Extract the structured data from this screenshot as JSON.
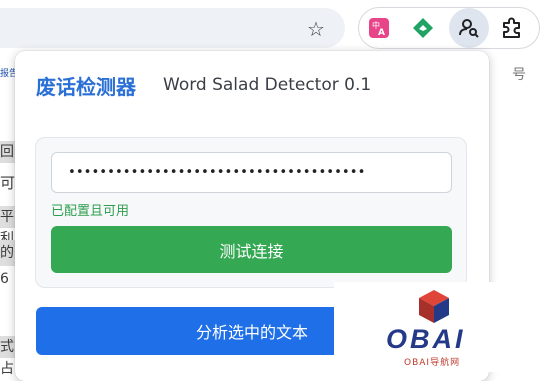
{
  "toolbar": {
    "bookmark_icon": "star-outline",
    "extensions": [
      {
        "name": "translate-extension",
        "icon": "translate-icon",
        "color": "#e8448a"
      },
      {
        "name": "green-extension",
        "icon": "leaf-icon",
        "color": "#21a366"
      },
      {
        "name": "word-salad-detector",
        "icon": "person-search-icon",
        "active": true
      },
      {
        "name": "extensions-menu",
        "icon": "puzzle-icon"
      }
    ]
  },
  "background": {
    "logo_snippet": "报告",
    "right_char": "号",
    "lines": [
      "回",
      "可能",
      "平利",
      "的6",
      "式占"
    ]
  },
  "popup": {
    "title": "废话检测器",
    "subtitle": "Word Salad Detector 0.1",
    "api_key_masked": "••••••••••••••••••••••••••••••••••••••",
    "status": "已配置且可用",
    "test_button": "测试连接",
    "analyze_button": "分析选中的文本"
  },
  "watermark": {
    "text": "OBAI",
    "subtext": "OBAI导航网"
  },
  "colors": {
    "title": "#2a6fd6",
    "status_ok": "#2e9e4e",
    "test_button": "#34a853",
    "analyze_button": "#1e6fe8"
  }
}
